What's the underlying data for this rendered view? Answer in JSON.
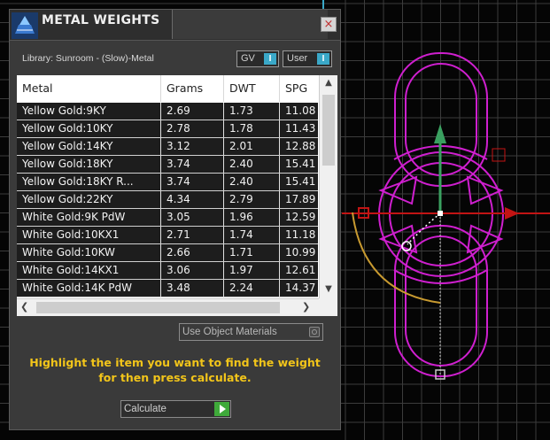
{
  "window": {
    "title": "METAL WEIGHTS",
    "close_glyph": "×"
  },
  "library_label": "Library: Sunroom - (Slow)-Metal",
  "toggles": {
    "gv": {
      "label": "GV",
      "knob": "I"
    },
    "user": {
      "label": "User",
      "knob": "I"
    }
  },
  "table": {
    "columns": [
      "Metal",
      "Grams",
      "DWT",
      "SPG"
    ],
    "rows": [
      [
        "Yellow Gold:9KY",
        "2.69",
        "1.73",
        "11.08"
      ],
      [
        "Yellow Gold:10KY",
        "2.78",
        "1.78",
        "11.43"
      ],
      [
        "Yellow Gold:14KY",
        "3.12",
        "2.01",
        "12.88"
      ],
      [
        "Yellow Gold:18KY",
        "3.74",
        "2.40",
        "15.41"
      ],
      [
        "Yellow Gold:18KY R...",
        "3.74",
        "2.40",
        "15.41"
      ],
      [
        "Yellow Gold:22KY",
        "4.34",
        "2.79",
        "17.89"
      ],
      [
        "White Gold:9K PdW",
        "3.05",
        "1.96",
        "12.59"
      ],
      [
        "White Gold:10KX1",
        "2.71",
        "1.74",
        "11.18"
      ],
      [
        "White Gold:10KW",
        "2.66",
        "1.71",
        "10.99"
      ],
      [
        "White Gold:14KX1",
        "3.06",
        "1.97",
        "12.61"
      ],
      [
        "White Gold:14K PdW",
        "3.48",
        "2.24",
        "14.37"
      ]
    ]
  },
  "use_object_materials": {
    "label": "Use Object Materials"
  },
  "hint": {
    "line1": "Highlight the item you want to find the weight",
    "line2": "for then press calculate."
  },
  "calculate_button": {
    "label": "Calculate"
  },
  "colors": {
    "accent_cyan": "#3aa8c8",
    "hint_yellow": "#f2c51a",
    "wire_magenta": "#d21ed2",
    "gizmo_red": "#c21414",
    "gizmo_green": "#3aa060",
    "grid": "#4a4a4a"
  },
  "icons": {
    "app_logo": "metal-weights-logo-icon",
    "close": "close-icon",
    "go": "play-arrow-icon"
  }
}
